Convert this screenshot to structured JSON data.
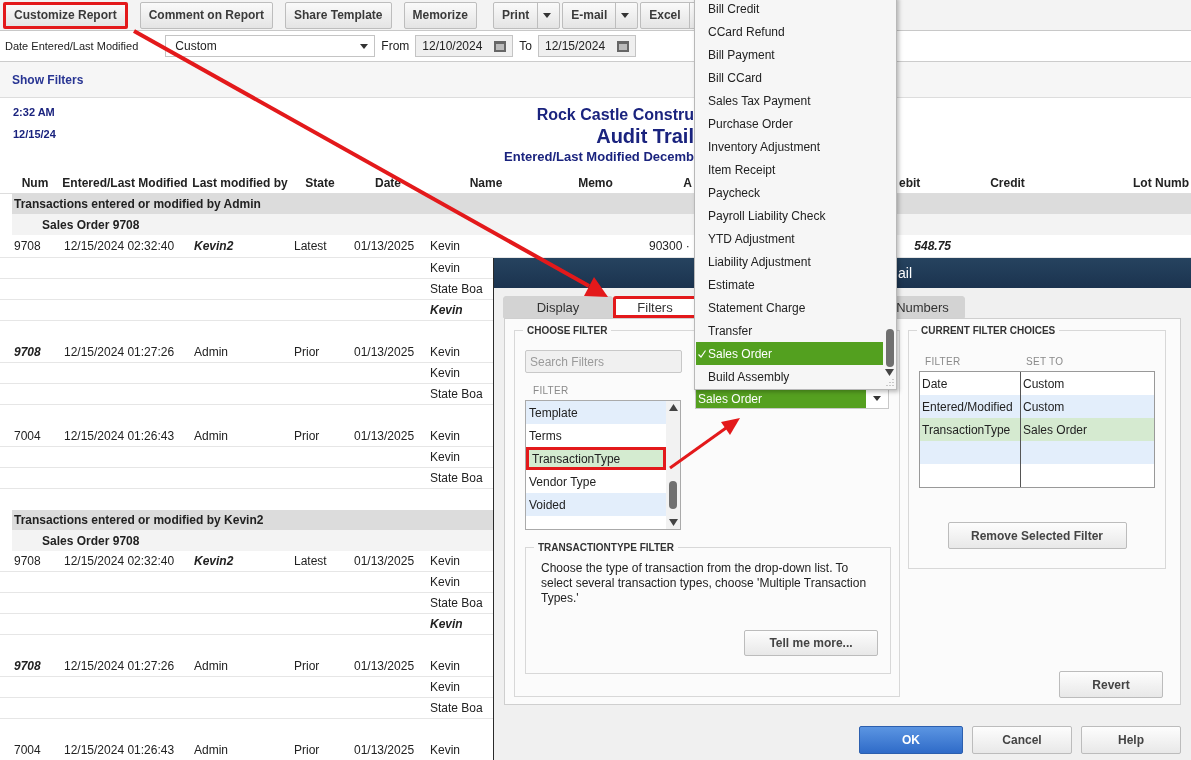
{
  "toolbar": {
    "buttons": [
      {
        "label": "Customize Report",
        "kind": "plain",
        "annotated": true
      },
      {
        "label": "Comment on Report",
        "kind": "plain",
        "annotated": false
      },
      {
        "label": "Share Template",
        "kind": "plain",
        "annotated": false
      },
      {
        "label": "Memorize",
        "kind": "plain",
        "annotated": false
      },
      {
        "label": "Print",
        "kind": "split",
        "annotated": false
      },
      {
        "label": "E-mail",
        "kind": "split",
        "annotated": false
      },
      {
        "label": "Excel",
        "kind": "split",
        "annotated": false
      }
    ]
  },
  "date_filter": {
    "label": "Date Entered/Last Modified",
    "range": "Custom",
    "from_label": "From",
    "from": "12/10/2024",
    "to_label": "To",
    "to": "12/15/2024"
  },
  "show_filters": "Show Filters",
  "report": {
    "time": "2:32 AM",
    "date": "12/15/24",
    "company": "Rock Castle Constru",
    "title": "Audit Trail",
    "subtitle": "Entered/Last Modified Decemb",
    "columns": [
      "Num",
      "Entered/Last Modified",
      "Last modified by",
      "State",
      "Date",
      "Name",
      "Memo",
      "A",
      "ebit",
      "Credit",
      "Lot Numb"
    ],
    "groups": [
      {
        "title": "Transactions entered or modified by Admin",
        "orders": [
          {
            "title": "Sales Order 9708",
            "records": [
              {
                "lines": [
                  {
                    "num": {
                      "text": "9708",
                      "bold": false
                    },
                    "entered_modified": {
                      "text": "12/15/2024 02:32:40",
                      "bold": false
                    },
                    "modified_by": {
                      "text": "Kevin2",
                      "bold": true
                    },
                    "state": {
                      "text": "Latest",
                      "bold": false
                    },
                    "date": {
                      "text": "01/13/2025",
                      "bold": false
                    },
                    "name": {
                      "text": "Kevin",
                      "bold": false
                    },
                    "column_8": {
                      "text": "90300 ·",
                      "bold": false
                    },
                    "debit": {
                      "text": "548.75",
                      "bold": true
                    }
                  },
                  {
                    "name": {
                      "text": "Kevin",
                      "bold": false
                    }
                  },
                  {
                    "name": {
                      "text": "State Boa",
                      "bold": false
                    }
                  },
                  {
                    "name": {
                      "text": "Kevin",
                      "bold": true
                    }
                  }
                ]
              },
              {
                "lines": [
                  {
                    "num": {
                      "text": "9708",
                      "bold": true
                    },
                    "entered_modified": {
                      "text": "12/15/2024 01:27:26",
                      "bold": false
                    },
                    "modified_by": {
                      "text": "Admin",
                      "bold": false
                    },
                    "state": {
                      "text": "Prior",
                      "bold": false
                    },
                    "date": {
                      "text": "01/13/2025",
                      "bold": false
                    },
                    "name": {
                      "text": "Kevin",
                      "bold": false
                    }
                  },
                  {
                    "name": {
                      "text": "Kevin",
                      "bold": false
                    }
                  },
                  {
                    "name": {
                      "text": "State Boa",
                      "bold": false
                    }
                  }
                ]
              },
              {
                "lines": [
                  {
                    "num": {
                      "text": "7004",
                      "bold": false
                    },
                    "entered_modified": {
                      "text": "12/15/2024 01:26:43",
                      "bold": false
                    },
                    "modified_by": {
                      "text": "Admin",
                      "bold": false
                    },
                    "state": {
                      "text": "Prior",
                      "bold": false
                    },
                    "date": {
                      "text": "01/13/2025",
                      "bold": false
                    },
                    "name": {
                      "text": "Kevin",
                      "bold": false
                    }
                  },
                  {
                    "name": {
                      "text": "Kevin",
                      "bold": false
                    }
                  },
                  {
                    "name": {
                      "text": "State Boa",
                      "bold": false
                    }
                  }
                ]
              }
            ]
          }
        ]
      },
      {
        "title": "Transactions entered or modified by Kevin2",
        "orders": [
          {
            "title": "Sales Order 9708",
            "records": [
              {
                "lines": [
                  {
                    "num": {
                      "text": "9708",
                      "bold": false
                    },
                    "entered_modified": {
                      "text": "12/15/2024 02:32:40",
                      "bold": false
                    },
                    "modified_by": {
                      "text": "Kevin2",
                      "bold": true
                    },
                    "state": {
                      "text": "Latest",
                      "bold": false
                    },
                    "date": {
                      "text": "01/13/2025",
                      "bold": false
                    },
                    "name": {
                      "text": "Kevin",
                      "bold": false
                    }
                  },
                  {
                    "name": {
                      "text": "Kevin",
                      "bold": false
                    }
                  },
                  {
                    "name": {
                      "text": "State Boa",
                      "bold": false
                    }
                  },
                  {
                    "name": {
                      "text": "Kevin",
                      "bold": true
                    }
                  }
                ]
              },
              {
                "lines": [
                  {
                    "num": {
                      "text": "9708",
                      "bold": true
                    },
                    "entered_modified": {
                      "text": "12/15/2024 01:27:26",
                      "bold": false
                    },
                    "modified_by": {
                      "text": "Admin",
                      "bold": false
                    },
                    "state": {
                      "text": "Prior",
                      "bold": false
                    },
                    "date": {
                      "text": "01/13/2025",
                      "bold": false
                    },
                    "name": {
                      "text": "Kevin",
                      "bold": false
                    }
                  },
                  {
                    "name": {
                      "text": "Kevin",
                      "bold": false
                    }
                  },
                  {
                    "name": {
                      "text": "State Boa",
                      "bold": false
                    }
                  }
                ]
              },
              {
                "lines": [
                  {
                    "num": {
                      "text": "7004",
                      "bold": false
                    },
                    "entered_modified": {
                      "text": "12/15/2024 01:26:43",
                      "bold": false
                    },
                    "modified_by": {
                      "text": "Admin",
                      "bold": false
                    },
                    "state": {
                      "text": "Prior",
                      "bold": false
                    },
                    "date": {
                      "text": "01/13/2025",
                      "bold": false
                    },
                    "name": {
                      "text": "Kevin",
                      "bold": false
                    }
                  }
                ]
              }
            ]
          }
        ]
      }
    ]
  },
  "dialog": {
    "title": "ail",
    "tabs": [
      {
        "label": "Display",
        "selected": false,
        "annotated": false
      },
      {
        "label": "Filters",
        "selected": true,
        "annotated": true
      },
      {
        "label": "Numbers",
        "selected": false,
        "annotated": false
      }
    ],
    "choose_filter": {
      "heading": "CHOOSE FILTER",
      "search": {
        "placeholder": "Search Filters"
      },
      "list_heading": "FILTER",
      "items": [
        {
          "label": "Template",
          "selected": false,
          "annotated": false
        },
        {
          "label": "Terms",
          "selected": false,
          "annotated": false
        },
        {
          "label": "TransactionType",
          "selected": true,
          "annotated": true
        },
        {
          "label": "Vendor Type",
          "selected": false,
          "annotated": false
        },
        {
          "label": "Voided",
          "selected": false,
          "annotated": false
        }
      ],
      "value": "Sales Order",
      "options": [
        {
          "label": "Bill Credit",
          "selected": false
        },
        {
          "label": "CCard Refund",
          "selected": false
        },
        {
          "label": "Bill Payment",
          "selected": false
        },
        {
          "label": "Bill CCard",
          "selected": false
        },
        {
          "label": "Sales Tax Payment",
          "selected": false
        },
        {
          "label": "Purchase Order",
          "selected": false
        },
        {
          "label": "Inventory Adjustment",
          "selected": false
        },
        {
          "label": "Item Receipt",
          "selected": false
        },
        {
          "label": "Paycheck",
          "selected": false
        },
        {
          "label": "Payroll Liability Check",
          "selected": false
        },
        {
          "label": "YTD Adjustment",
          "selected": false
        },
        {
          "label": "Liability Adjustment",
          "selected": false
        },
        {
          "label": "Estimate",
          "selected": false
        },
        {
          "label": "Statement Charge",
          "selected": false
        },
        {
          "label": "Transfer",
          "selected": false
        },
        {
          "label": "Sales Order",
          "selected": true
        },
        {
          "label": "Build Assembly",
          "selected": false
        }
      ],
      "description": {
        "heading": "TRANSACTIONTYPE FILTER",
        "text": "Choose the type of transaction from the drop-down list. To select several transaction types, choose 'Multiple Transaction Types.'",
        "button": "Tell me more..."
      }
    },
    "current_filters": {
      "heading": "CURRENT FILTER CHOICES",
      "columns": [
        "FILTER",
        "SET TO"
      ],
      "rows": [
        {
          "filter": "Date",
          "set_to": "Custom",
          "selected": false
        },
        {
          "filter": "Entered/Modified",
          "set_to": "Custom",
          "selected": false
        },
        {
          "filter": "TransactionType",
          "set_to": "Sales Order",
          "selected": true
        }
      ],
      "button": "Remove Selected Filter"
    },
    "revert_button": "Revert",
    "buttons": [
      {
        "label": "OK",
        "kind": "primary"
      },
      {
        "label": "Cancel",
        "kind": "secondary"
      },
      {
        "label": "Help",
        "kind": "secondary"
      }
    ]
  }
}
